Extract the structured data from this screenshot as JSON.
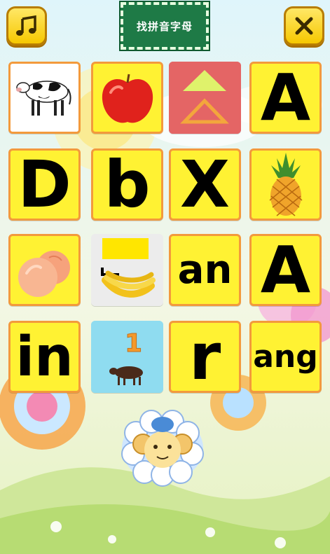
{
  "header": {
    "title": "找拼音字母",
    "music_icon": "music-note-icon",
    "close_icon": "close-icon",
    "accent_color": "#f6c800",
    "board_color": "#1e7a46"
  },
  "grid": {
    "card_color": "#fff233",
    "border_color": "#f39a3c",
    "cards": [
      {
        "kind": "image",
        "image": "cow"
      },
      {
        "kind": "image",
        "image": "apple"
      },
      {
        "kind": "image",
        "image": "triangles"
      },
      {
        "kind": "text",
        "text": "A"
      },
      {
        "kind": "text",
        "text": "D"
      },
      {
        "kind": "text",
        "text": "b"
      },
      {
        "kind": "text",
        "text": "X"
      },
      {
        "kind": "image",
        "image": "pineapple"
      },
      {
        "kind": "image",
        "image": "peach"
      },
      {
        "kind": "image",
        "image": "banana"
      },
      {
        "kind": "text",
        "text": "an"
      },
      {
        "kind": "text",
        "text": "A"
      },
      {
        "kind": "text",
        "text": "in"
      },
      {
        "kind": "image",
        "image": "number-one-with-cow",
        "caption": "1"
      },
      {
        "kind": "text",
        "text": "r"
      },
      {
        "kind": "text",
        "text": "ang"
      }
    ]
  },
  "mascot": {
    "image": "sheep-mascot"
  }
}
